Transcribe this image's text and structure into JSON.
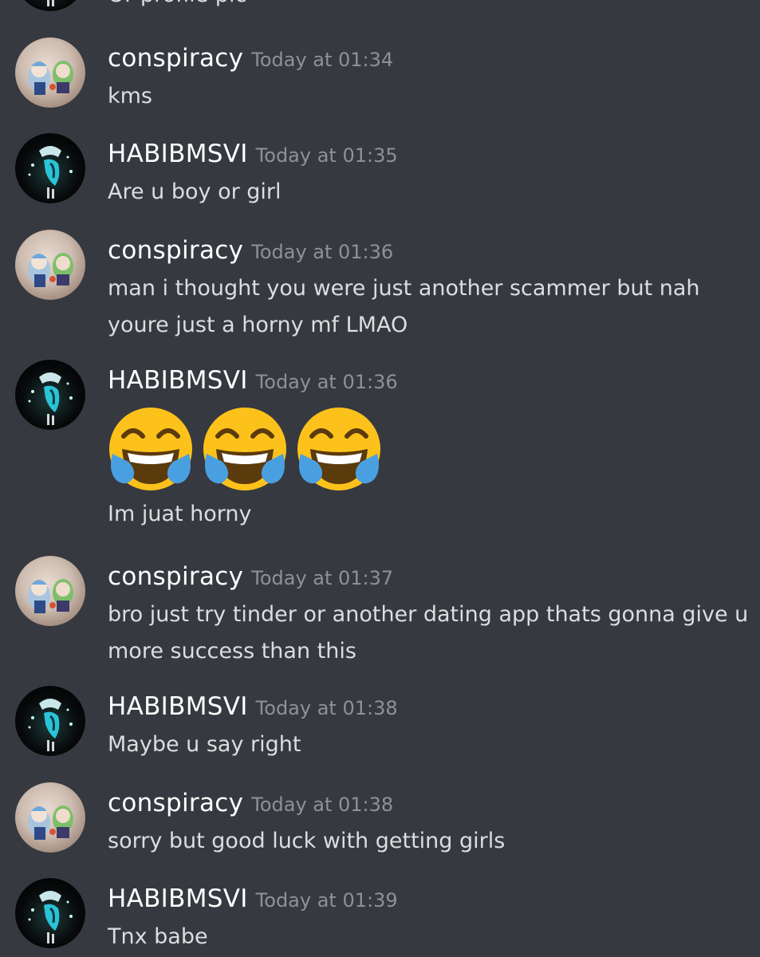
{
  "partial_top_text": "Or profile pic",
  "icons": {
    "conspiracy_avatar": "avatar-conspiracy",
    "habib_avatar": "avatar-habibmsvi",
    "emoji": "face-with-tears-of-joy"
  },
  "colors": {
    "background": "#36393f",
    "username": "#ffffff",
    "timestamp": "#8e9297",
    "message_text": "#dcddde"
  },
  "messages": [
    {
      "author": "conspiracy",
      "time": "Today at 01:34",
      "lines": [
        "kms"
      ]
    },
    {
      "author": "HABIBMSVI",
      "time": "Today at 01:35",
      "lines": [
        "Are u boy or girl"
      ]
    },
    {
      "author": "conspiracy",
      "time": "Today at 01:36",
      "lines": [
        "man i thought you were just another scammer but nah",
        "youre just a horny mf LMAO"
      ]
    },
    {
      "author": "HABIBMSVI",
      "time": "Today at 01:36",
      "emoji_count": 3,
      "lines": [
        "Im juat horny"
      ]
    },
    {
      "author": "conspiracy",
      "time": "Today at 01:37",
      "lines": [
        "bro just try tinder or another dating app thats gonna give u",
        "more success than this"
      ]
    },
    {
      "author": "HABIBMSVI",
      "time": "Today at 01:38",
      "lines": [
        "Maybe u say right"
      ]
    },
    {
      "author": "conspiracy",
      "time": "Today at 01:38",
      "lines": [
        "sorry but good luck with getting girls"
      ]
    },
    {
      "author": "HABIBMSVI",
      "time": "Today at 01:39",
      "lines": [
        "Tnx babe"
      ]
    }
  ]
}
